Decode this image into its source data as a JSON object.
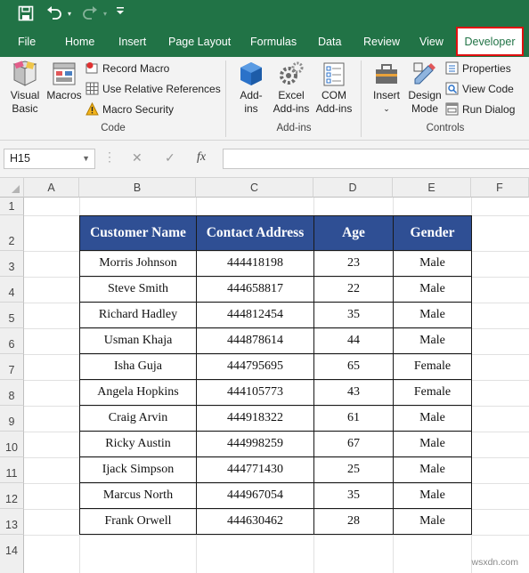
{
  "quick_access": {
    "save_icon": "save-icon",
    "undo_icon": "undo-icon",
    "redo_icon": "redo-icon",
    "customize_icon": "customize-icon"
  },
  "tabs": [
    "File",
    "Home",
    "Insert",
    "Page Layout",
    "Formulas",
    "Data",
    "Review",
    "View",
    "Developer"
  ],
  "active_tab": "Developer",
  "ribbon": {
    "code": {
      "visual_basic": [
        "Visual",
        "Basic"
      ],
      "macros": "Macros",
      "record_macro": "Record Macro",
      "relative_refs": "Use Relative References",
      "macro_security": "Macro Security",
      "group": "Code"
    },
    "addins": {
      "addins": [
        "Add-",
        "ins"
      ],
      "excel_addins": [
        "Excel",
        "Add-ins"
      ],
      "com_addins": [
        "COM",
        "Add-ins"
      ],
      "group": "Add-ins"
    },
    "controls": {
      "insert": "Insert",
      "design_mode": [
        "Design",
        "Mode"
      ],
      "properties": "Properties",
      "view_code": "View Code",
      "run_dialog": "Run Dialog",
      "group": "Controls"
    }
  },
  "formula_bar": {
    "name_box": "H15",
    "cancel": "✕",
    "enter": "✓",
    "fx": "fx",
    "formula": ""
  },
  "columns": [
    "A",
    "B",
    "C",
    "D",
    "E",
    "F"
  ],
  "rows": [
    "1",
    "2",
    "3",
    "4",
    "5",
    "6",
    "7",
    "8",
    "9",
    "10",
    "11",
    "12",
    "13",
    "14"
  ],
  "table": {
    "headers": [
      "Customer Name",
      "Contact Address",
      "Age",
      "Gender"
    ],
    "rows": [
      [
        "Morris Johnson",
        "444418198",
        "23",
        "Male"
      ],
      [
        "Steve Smith",
        "444658817",
        "22",
        "Male"
      ],
      [
        "Richard Hadley",
        "444812454",
        "35",
        "Male"
      ],
      [
        "Usman Khaja",
        "444878614",
        "44",
        "Male"
      ],
      [
        "Isha Guja",
        "444795695",
        "65",
        "Female"
      ],
      [
        "Angela Hopkins",
        "444105773",
        "43",
        "Female"
      ],
      [
        "Craig Arvin",
        "444918322",
        "61",
        "Male"
      ],
      [
        "Ricky Austin",
        "444998259",
        "67",
        "Male"
      ],
      [
        "Ijack Simpson",
        "444771430",
        "25",
        "Male"
      ],
      [
        "Marcus North",
        "444967054",
        "35",
        "Male"
      ],
      [
        "Frank Orwell",
        "444630462",
        "28",
        "Male"
      ]
    ]
  },
  "watermark": "wsxdn.com",
  "colors": {
    "excel_green": "#217346",
    "header_fill": "#2f4f94",
    "highlight": "#e01010"
  }
}
